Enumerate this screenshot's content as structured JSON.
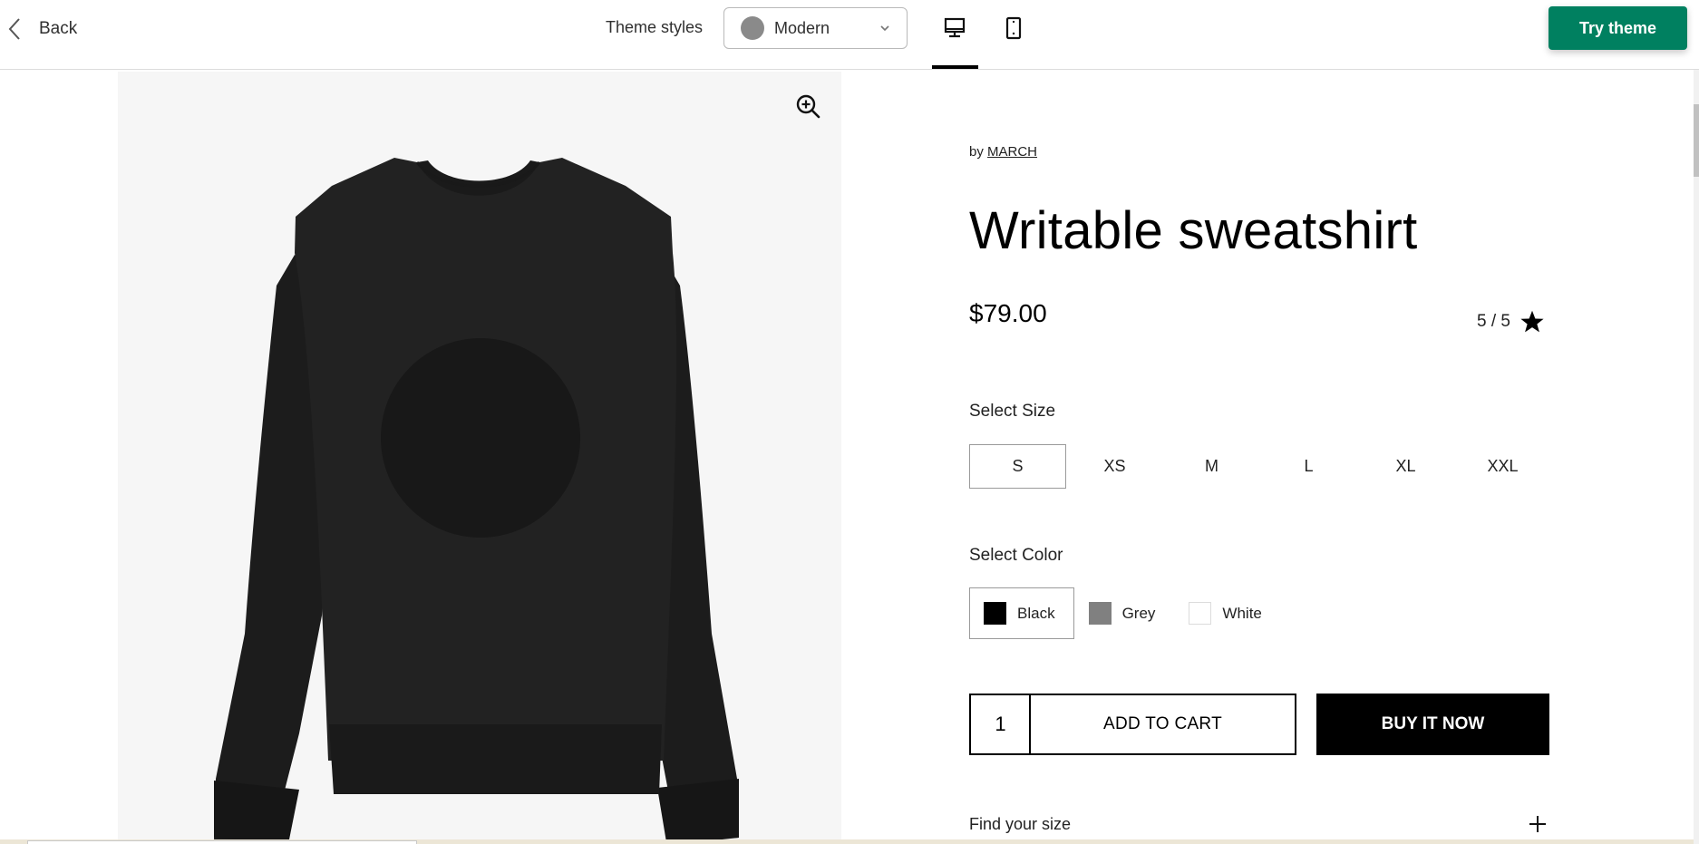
{
  "header": {
    "back_label": "Back",
    "back_icon": "chevron-left-icon",
    "theme_styles_label": "Theme styles",
    "theme_select": {
      "value": "Modern",
      "swatch_color": "#8a8a8a"
    },
    "view_modes": [
      {
        "name": "desktop",
        "icon": "desktop-icon",
        "active": true
      },
      {
        "name": "mobile",
        "icon": "mobile-icon",
        "active": false
      }
    ],
    "try_theme_label": "Try theme",
    "accent_color": "#008060"
  },
  "product": {
    "image_alt": "Black crew-neck sweatshirt with round circle print",
    "zoom_icon": "zoom-in-icon",
    "vendor_prefix": "by",
    "vendor": "MARCH",
    "title": "Writable sweatshirt",
    "price": "$79.00",
    "rating": "5 / 5",
    "rating_value": 5,
    "rating_max": 5,
    "size_label": "Select Size",
    "sizes": [
      {
        "label": "S",
        "selected": true
      },
      {
        "label": "XS",
        "selected": false
      },
      {
        "label": "M",
        "selected": false
      },
      {
        "label": "L",
        "selected": false
      },
      {
        "label": "XL",
        "selected": false
      },
      {
        "label": "XXL",
        "selected": false
      }
    ],
    "color_label": "Select Color",
    "colors": [
      {
        "label": "Black",
        "swatch": "#000000",
        "selected": true
      },
      {
        "label": "Grey",
        "swatch": "#808080",
        "selected": false
      },
      {
        "label": "White",
        "swatch": "#ffffff",
        "selected": false
      }
    ],
    "quantity": "1",
    "add_to_cart_label": "ADD TO CART",
    "buy_now_label": "BUY IT NOW",
    "find_size_label": "Find your size"
  }
}
